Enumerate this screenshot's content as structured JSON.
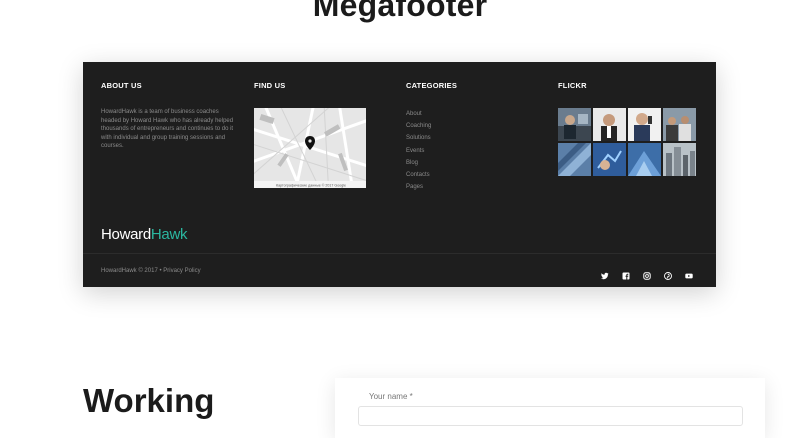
{
  "page": {
    "heading": "Megafooter"
  },
  "footer": {
    "about": {
      "title": "ABOUT US",
      "text": "HowardHawk is a team of business coaches headed by Howard Hawk who has already helped thousands of entrepreneurs and continues to do it with individual and group training sessions and courses."
    },
    "find_us": {
      "title": "FIND US",
      "map_attribution": "Картографические данные © 2017 Google"
    },
    "categories": {
      "title": "CATEGORIES",
      "items": [
        "About",
        "Coaching",
        "Solutions",
        "Events",
        "Blog",
        "Contacts",
        "Pages"
      ]
    },
    "flickr": {
      "title": "FLICKR"
    },
    "logo": {
      "part1": "Howard",
      "part2": "Hawk",
      "accent_color": "#2bb7a0"
    },
    "copyright": {
      "text": "HowardHawk ©  2017 •",
      "privacy": "Privacy Policy"
    },
    "socials": [
      "twitter-icon",
      "facebook-icon",
      "instagram-icon",
      "pinterest-icon",
      "youtube-icon"
    ]
  },
  "working": {
    "heading": "Working"
  },
  "form": {
    "name_label": "Your name *"
  },
  "colors": {
    "footer_bg": "#1e1e1e",
    "muted_text": "#8b8b8b",
    "accent": "#2bb7a0"
  }
}
